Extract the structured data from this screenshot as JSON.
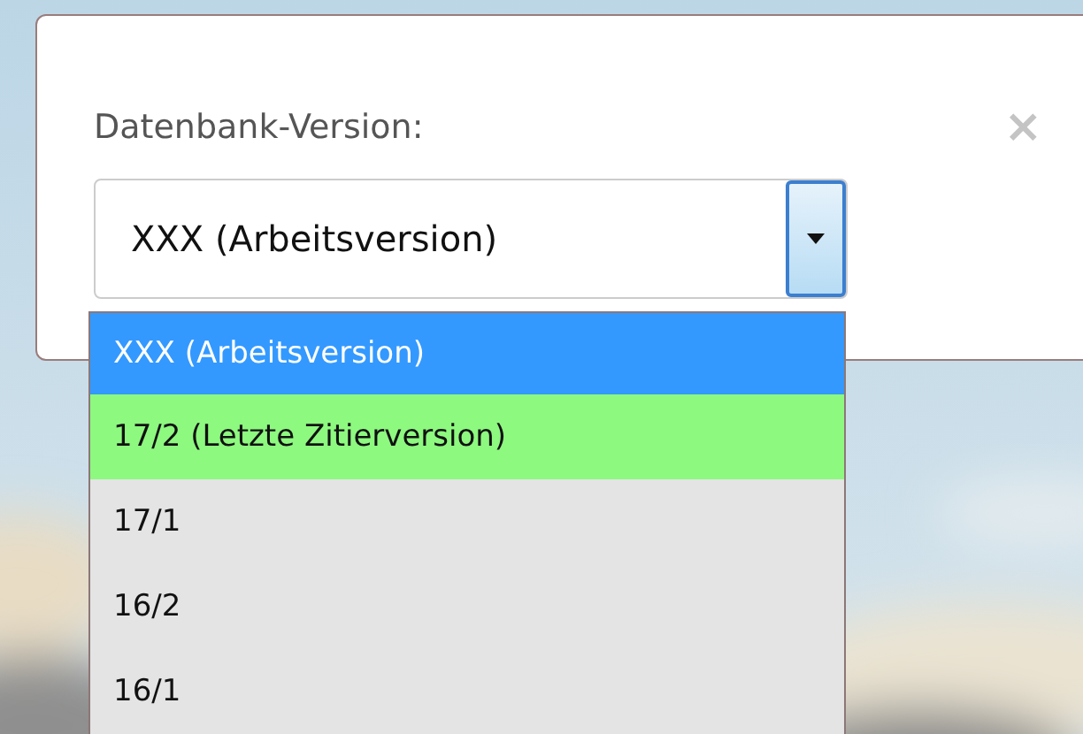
{
  "dialog": {
    "label": "Datenbank-Version:",
    "close": "×"
  },
  "select": {
    "value": "XXX (Arbeitsversion)",
    "expanded": true
  },
  "options": [
    {
      "label": "XXX (Arbeitsversion)",
      "selected": true
    },
    {
      "label": "17/2 (Letzte Zitierversion)",
      "selected": false,
      "color": "#8df97f"
    },
    {
      "label": "17/1",
      "selected": false,
      "color": "#e4e4e4"
    },
    {
      "label": "16/2",
      "selected": false,
      "color": "#e4e4e4"
    },
    {
      "label": "16/1",
      "selected": false,
      "color": "#e4e4e4"
    }
  ]
}
